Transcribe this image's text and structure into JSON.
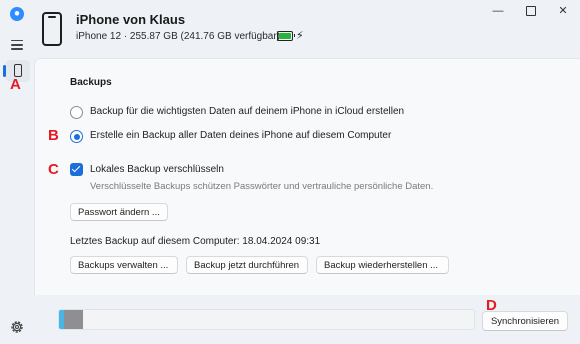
{
  "device": {
    "name": "iPhone von Klaus",
    "info": "iPhone 12 · 255.87 GB (241.76 GB verfügbar)",
    "battery_icon": "battery-charging-icon",
    "battery_color": "#29b33c"
  },
  "window_controls": {
    "minimize": "—",
    "maximize": "",
    "close": "✕"
  },
  "backups": {
    "section_title": "Backups",
    "options": [
      {
        "label": "Backup für die wichtigsten Daten auf deinem iPhone in iCloud erstellen",
        "selected": false
      },
      {
        "label": "Erstelle ein Backup aller Daten deines iPhone auf diesem Computer",
        "selected": true
      }
    ],
    "encrypt_label": "Lokales Backup verschlüsseln",
    "encrypt_checked": true,
    "encrypt_hint": "Verschlüsselte Backups schützen Passwörter und vertrauliche persönliche Daten.",
    "change_password_label": "Passwort ändern ...",
    "last_backup": "Letztes Backup auf diesem Computer: 18.04.2024 09:31",
    "manage_label": "Backups verwalten ...",
    "backup_now_label": "Backup jetzt durchführen",
    "restore_label": "Backup wiederherstellen ..."
  },
  "footer": {
    "sync_label": "Synchronisieren",
    "storage_segments": [
      {
        "fraction": 0.012,
        "color": "#49b5e7"
      },
      {
        "fraction": 0.045,
        "color": "#8f8f93"
      }
    ]
  },
  "annotations": {
    "a": "A",
    "b": "B",
    "c": "C",
    "d": "D",
    "color": "#e31b23"
  },
  "accent_color": "#1a6fdc"
}
